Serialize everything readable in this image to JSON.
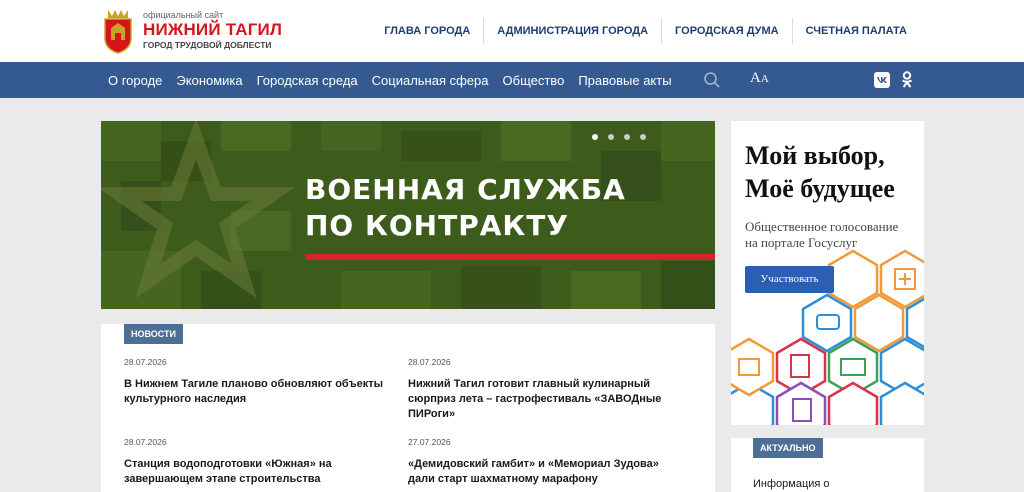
{
  "header": {
    "logo_small": "официальный сайт",
    "logo_title": "НИЖНИЙ ТАГИЛ",
    "logo_subtitle": "ГОРОД ТРУДОВОЙ ДОБЛЕСТИ",
    "top_links": [
      "ГЛАВА ГОРОДА",
      "АДМИНИСТРАЦИЯ ГОРОДА",
      "ГОРОДСКАЯ ДУМА",
      "СЧЕТНАЯ ПАЛАТА"
    ]
  },
  "nav": {
    "items": [
      "О городе",
      "Экономика",
      "Городская среда",
      "Социальная сфера",
      "Общество",
      "Правовые акты"
    ],
    "font_label_big": "А",
    "font_label_small": "А",
    "icons": [
      "search-icon",
      "font-size-icon",
      "vk-icon",
      "odnoklassniki-icon"
    ]
  },
  "banner": {
    "line1": "ВОЕННАЯ СЛУЖБА",
    "line2": "ПО КОНТРАКТУ",
    "slides_total": 4,
    "active_slide": 1
  },
  "news": {
    "tag": "НОВОСТИ",
    "items": [
      {
        "date": "28.07.2026",
        "title": "В Нижнем Тагиле планово обновляют объекты культурного наследия"
      },
      {
        "date": "28.07.2026",
        "title": "Нижний Тагил готовит главный кулинарный сюрприз лета – гастрофестиваль «ЗАВОДные ПИРоги»"
      },
      {
        "date": "28.07.2026",
        "title": "Станция водоподготовки «Южная» на завершающем этапе строительства"
      },
      {
        "date": "27.07.2026",
        "title": "«Демидовский гамбит» и «Мемориал Зудова» дали старт шахматному марафону"
      }
    ]
  },
  "promo": {
    "title_line1": "Мой выбор,",
    "title_line2": "Моё будущее",
    "text_line1": "Общественное голосование",
    "text_line2": "на портале Госуслуг",
    "button": "Участвовать"
  },
  "actual": {
    "tag": "АКТУАЛЬНО",
    "text": "Информация о"
  },
  "colors": {
    "brand_red": "#d4161c",
    "nav_blue": "#345a91",
    "tag_blue": "#4d6f96",
    "banner_green": "#3c5a1a",
    "banner_red": "#d9232a",
    "button_blue": "#2a5fb3"
  }
}
